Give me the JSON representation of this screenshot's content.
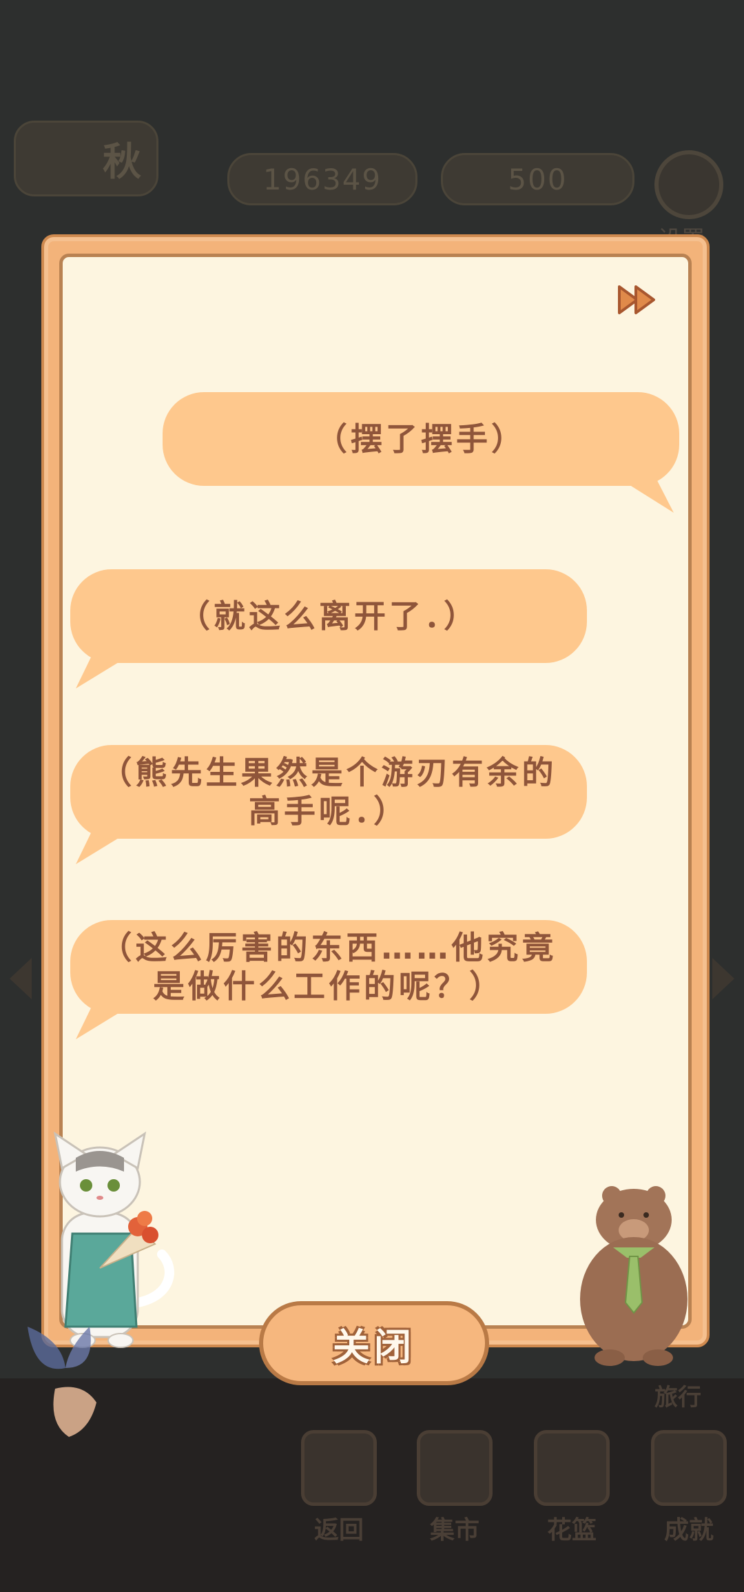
{
  "hud": {
    "season": "秋",
    "fish_count": "196349",
    "cheese_count": "500",
    "settings_label": "设置"
  },
  "dialog": {
    "lines": [
      "（摆了摆手）",
      "（就这么离开了．）",
      "（熊先生果然是个游刃有余的高手呢．）",
      "（这么厉害的东西……他究竟是做什么工作的呢？）"
    ],
    "close_label": "关闭"
  },
  "bottom_nav": {
    "items": [
      {
        "label": "返回",
        "icon": "window-icon"
      },
      {
        "label": "集市",
        "icon": "market-stall-icon"
      },
      {
        "label": "花篮",
        "icon": "flower-basket-icon"
      },
      {
        "label": "成就",
        "icon": "trophy-icon"
      }
    ],
    "travel_label": "旅行"
  },
  "colors": {
    "bubble": "#fec88d",
    "bubble_text": "#8f553a",
    "paper": "#fdf5e0",
    "frame": "#f3b37a"
  }
}
